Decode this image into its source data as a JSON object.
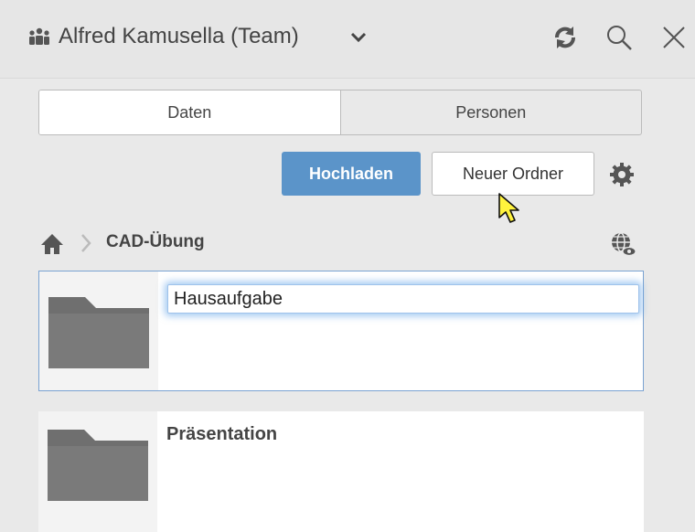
{
  "header": {
    "team_title": "Alfred Kamusella (Team)",
    "icons": [
      "team-icon",
      "chevron-down-icon",
      "refresh-icon",
      "search-icon",
      "close-icon"
    ]
  },
  "tabs": [
    {
      "label": "Daten",
      "active": true
    },
    {
      "label": "Personen",
      "active": false
    }
  ],
  "toolbar": {
    "upload_label": "Hochladen",
    "new_folder_label": "Neuer Ordner",
    "accent_color": "#5b94c9"
  },
  "breadcrumb": {
    "current": "CAD-Übung"
  },
  "folders": [
    {
      "name": "Hausaufgabe",
      "editing": true
    },
    {
      "name": "Präsentation",
      "editing": false
    }
  ]
}
